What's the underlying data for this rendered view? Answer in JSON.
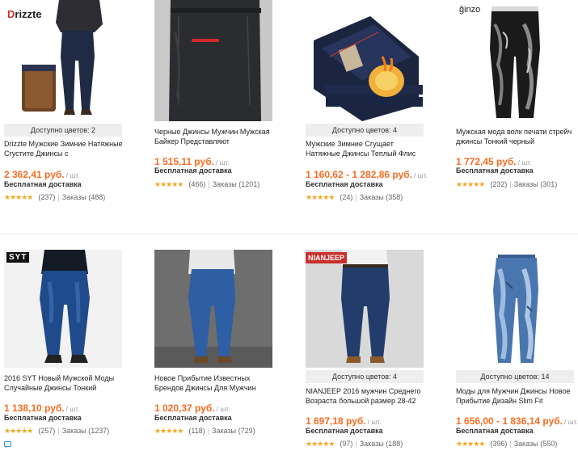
{
  "products": [
    {
      "brand": "Drizzte",
      "colors": "Доступно цветов: 2",
      "title": "Drizzte Мужские Зимние Натяжные Сгустите Джинсы с",
      "price": "2 362,41 руб.",
      "per": "/ шт.",
      "shipping": "Бесплатная доставка",
      "reviews": "(237)",
      "orders": "Заказы (488)"
    },
    {
      "colors": "",
      "title": "Черные Джинсы Мужчин Мужская Байкер Представляют",
      "price": "1 515,11 руб.",
      "per": "/ шт.",
      "shipping": "Бесплатная доставка",
      "reviews": "(466)",
      "orders": "Заказы (1201)"
    },
    {
      "colors": "Доступно цветов: 4",
      "title": "Мужские Зимние Сгущает Натяжные Джинсы Теплый Флис",
      "price": "1 160,62 - 1 282,86 руб.",
      "per": "/ шт.",
      "shipping": "Бесплатная доставка",
      "reviews": "(24)",
      "orders": "Заказы (358)"
    },
    {
      "brand": "ĝinzo",
      "colors": "",
      "title": "Мужская мода волк печати стрейч джинсы Тонкий черный",
      "price": "1 772,45 руб.",
      "per": "/ шт.",
      "shipping": "Бесплатная доставка",
      "reviews": "(232)",
      "orders": "Заказы (301)"
    },
    {
      "brand": "SYT",
      "colors": "",
      "title": "2016 SYT Новый Мужской Моды Случайные Джинсы Тонкий",
      "price": "1 138,10 руб.",
      "per": "/ шт.",
      "shipping": "Бесплатная доставка",
      "reviews": "(257)",
      "orders": "Заказы (1237)"
    },
    {
      "colors": "",
      "title": "Новое Прибытие Известных Брендов Джинсы Для Мужчин",
      "price": "1 020,37 руб.",
      "per": "/ шт.",
      "shipping": "Бесплатная доставка",
      "reviews": "(118)",
      "orders": "Заказы (729)"
    },
    {
      "brand": "NIANJEEP",
      "colors": "Доступно цветов: 4",
      "title": "NIANJEEP 2016 мужчин Среднего Возраста большой размер 28-42",
      "price": "1 697,18 руб.",
      "per": "/ шт.",
      "shipping": "Бесплатная доставка",
      "reviews": "(97)",
      "orders": "Заказы (188)"
    },
    {
      "colors": "Доступно цветов: 14",
      "title": "Моды для Мужчин Джинсы Новое Прибытие Дизайн Slim Fit",
      "price": "1 656,00 - 1 836,14 руб.",
      "per": "/ шт.",
      "shipping": "Бесплатная доставка",
      "reviews": "(396)",
      "orders": "Заказы (550)"
    }
  ],
  "stars_glyph": "★★★★★",
  "separator": "|",
  "colors_theme": {
    "price": "#f56d24",
    "stars": "#f6a623"
  }
}
